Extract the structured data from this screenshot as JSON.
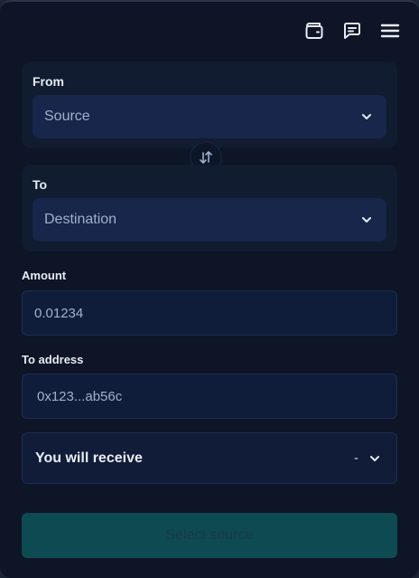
{
  "toolbar": {
    "icons": [
      "wallet-icon",
      "chat-icon",
      "menu-icon"
    ]
  },
  "from": {
    "label": "From",
    "placeholder": "Source"
  },
  "to": {
    "label": "To",
    "placeholder": "Destination"
  },
  "amount": {
    "label": "Amount",
    "value": "0.01234"
  },
  "to_address": {
    "label": "To address",
    "value": "0x123...ab56c"
  },
  "receive": {
    "label": "You will receive",
    "value": "-"
  },
  "action": {
    "label": "Select source"
  },
  "colors": {
    "background": "#0d1526",
    "panel": "#111c31",
    "select": "#17264a",
    "cta": "#0e4a52"
  }
}
